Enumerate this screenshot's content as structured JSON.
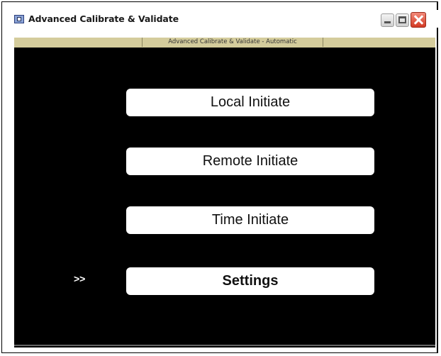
{
  "window": {
    "title": "Advanced Calibrate & Validate",
    "icon": "app-window-icon",
    "controls": [
      "minimize-icon",
      "maximize-icon",
      "close-icon"
    ]
  },
  "subheader": {
    "label": "Advanced Calibrate & Validate - Automatic"
  },
  "menu": {
    "items": [
      {
        "label": "Local Initiate"
      },
      {
        "label": "Remote Initiate"
      },
      {
        "label": "Time Initiate"
      },
      {
        "label": "Settings"
      }
    ],
    "selected_marker": ">>"
  },
  "colors": {
    "content_background": "#000000",
    "button_background": "#ffffff",
    "subbar_background": "#d4cc9c",
    "close_button": "#d23a24"
  }
}
